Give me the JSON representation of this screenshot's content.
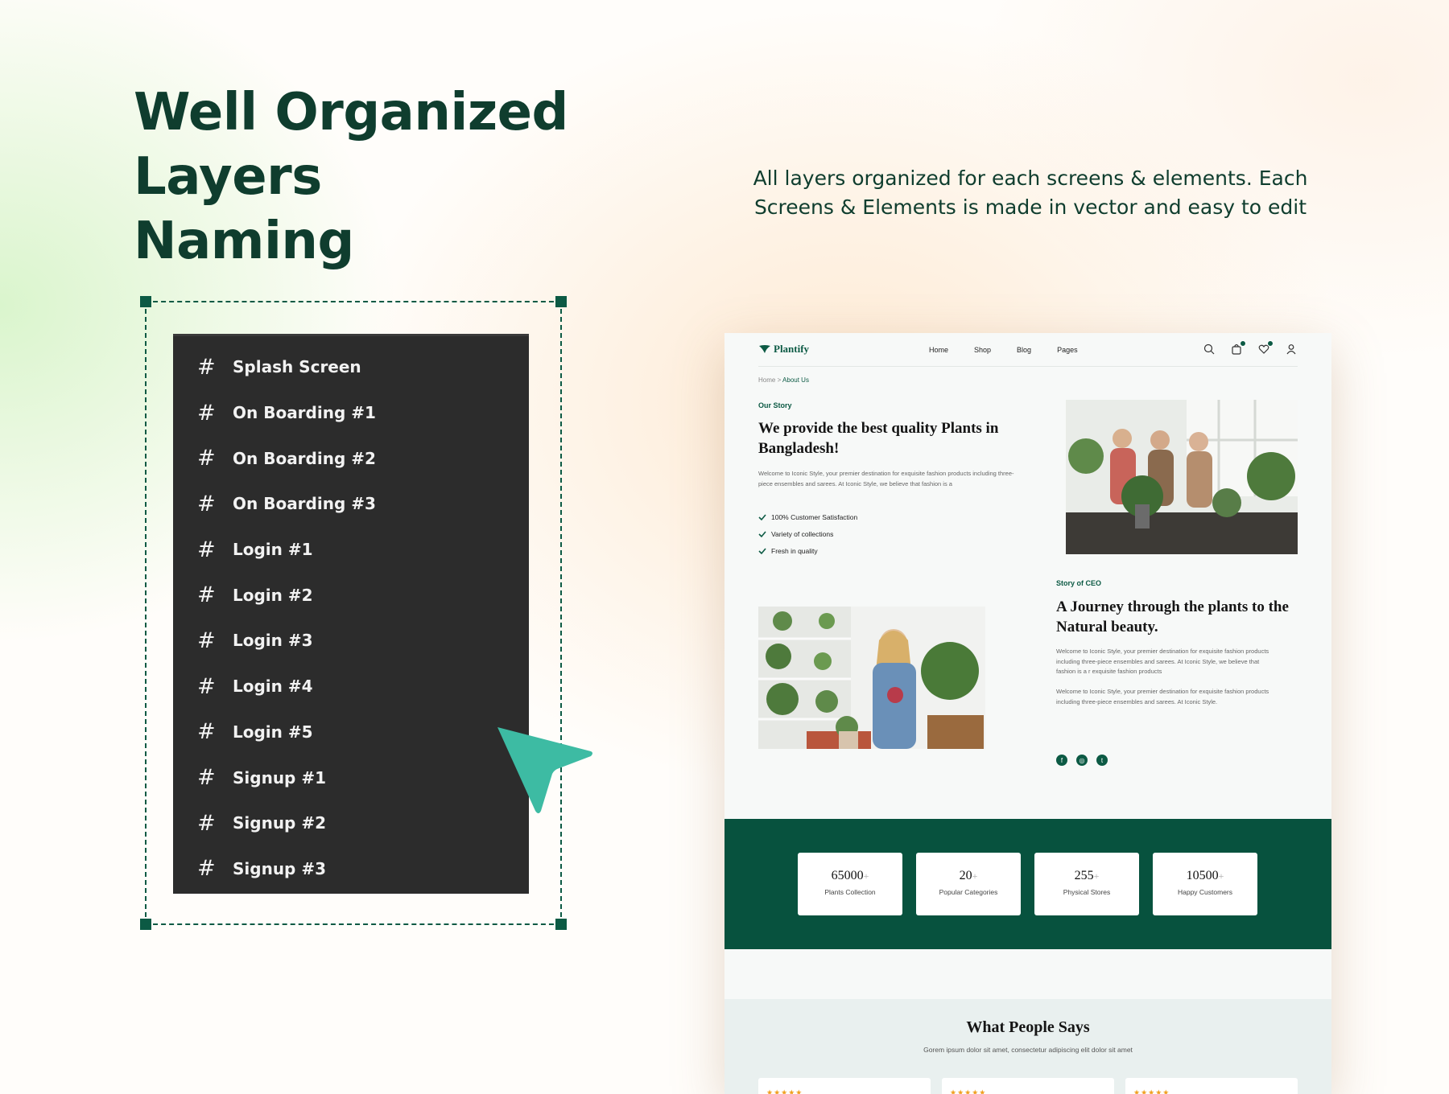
{
  "hero": {
    "title_line1": "Well Organized Layers",
    "title_line2": "Naming",
    "description": "All layers organized for each screens & elements. Each Screens & Elements is made in vector and easy to edit"
  },
  "layers_panel": {
    "frame_icon": "hash-frame-icon",
    "items": [
      "Splash Screen",
      "On Boarding #1",
      "On Boarding #2",
      "On Boarding #3",
      "Login #1",
      "Login #2",
      "Login #3",
      "Login #4",
      "Login #5",
      "Signup #1",
      "Signup #2",
      "Signup #3"
    ]
  },
  "cursor": {
    "icon": "pointer-arrow-icon",
    "color": "#3dbba3"
  },
  "site": {
    "logo": "Plantify",
    "nav": [
      "Home",
      "Shop",
      "Blog",
      "Pages"
    ],
    "icons": [
      "search-icon",
      "bag-icon",
      "heart-icon",
      "user-icon"
    ],
    "breadcrumb": {
      "home": "Home",
      "separator": " > ",
      "current": "About Us"
    },
    "story": {
      "eyebrow": "Our Story",
      "title": "We provide the best quality Plants in Bangladesh!",
      "text": "Welcome to Iconic Style, your premier destination for exquisite fashion products including three-piece ensembles and sarees. At Iconic Style, we believe that fashion is a",
      "checks": [
        "100% Customer Satisfaction",
        "Variety of collections",
        "Fresh in quality"
      ]
    },
    "ceo": {
      "eyebrow": "Story of CEO",
      "title": "A Journey through the plants to the Natural beauty.",
      "text1": "Welcome to Iconic Style, your premier destination for exquisite fashion products including three-piece ensembles and sarees. At Iconic Style, we believe that fashion is a r exquisite fashion products",
      "text2": "Welcome to Iconic Style, your premier destination for exquisite fashion products including three-piece ensembles and sarees. At Iconic Style.",
      "socials": [
        "facebook-icon",
        "instagram-icon",
        "twitter-icon"
      ]
    },
    "stats": [
      {
        "value": "65000",
        "suffix": "+",
        "label": "Plants Collection"
      },
      {
        "value": "20",
        "suffix": "+",
        "label": "Popular Categories"
      },
      {
        "value": "255",
        "suffix": "+",
        "label": "Physical Stores"
      },
      {
        "value": "10500",
        "suffix": "+",
        "label": "Happy Customers"
      }
    ],
    "testimonials": {
      "title": "What People Says",
      "subtitle": "Gorem ipsum dolor sit amet, consectetur adipiscing elit dolor sit amet",
      "stars": "★★★★★",
      "rating": 5
    },
    "colors": {
      "brand": "#0c5a44",
      "band": "#07523e",
      "star": "#f0a020"
    }
  }
}
